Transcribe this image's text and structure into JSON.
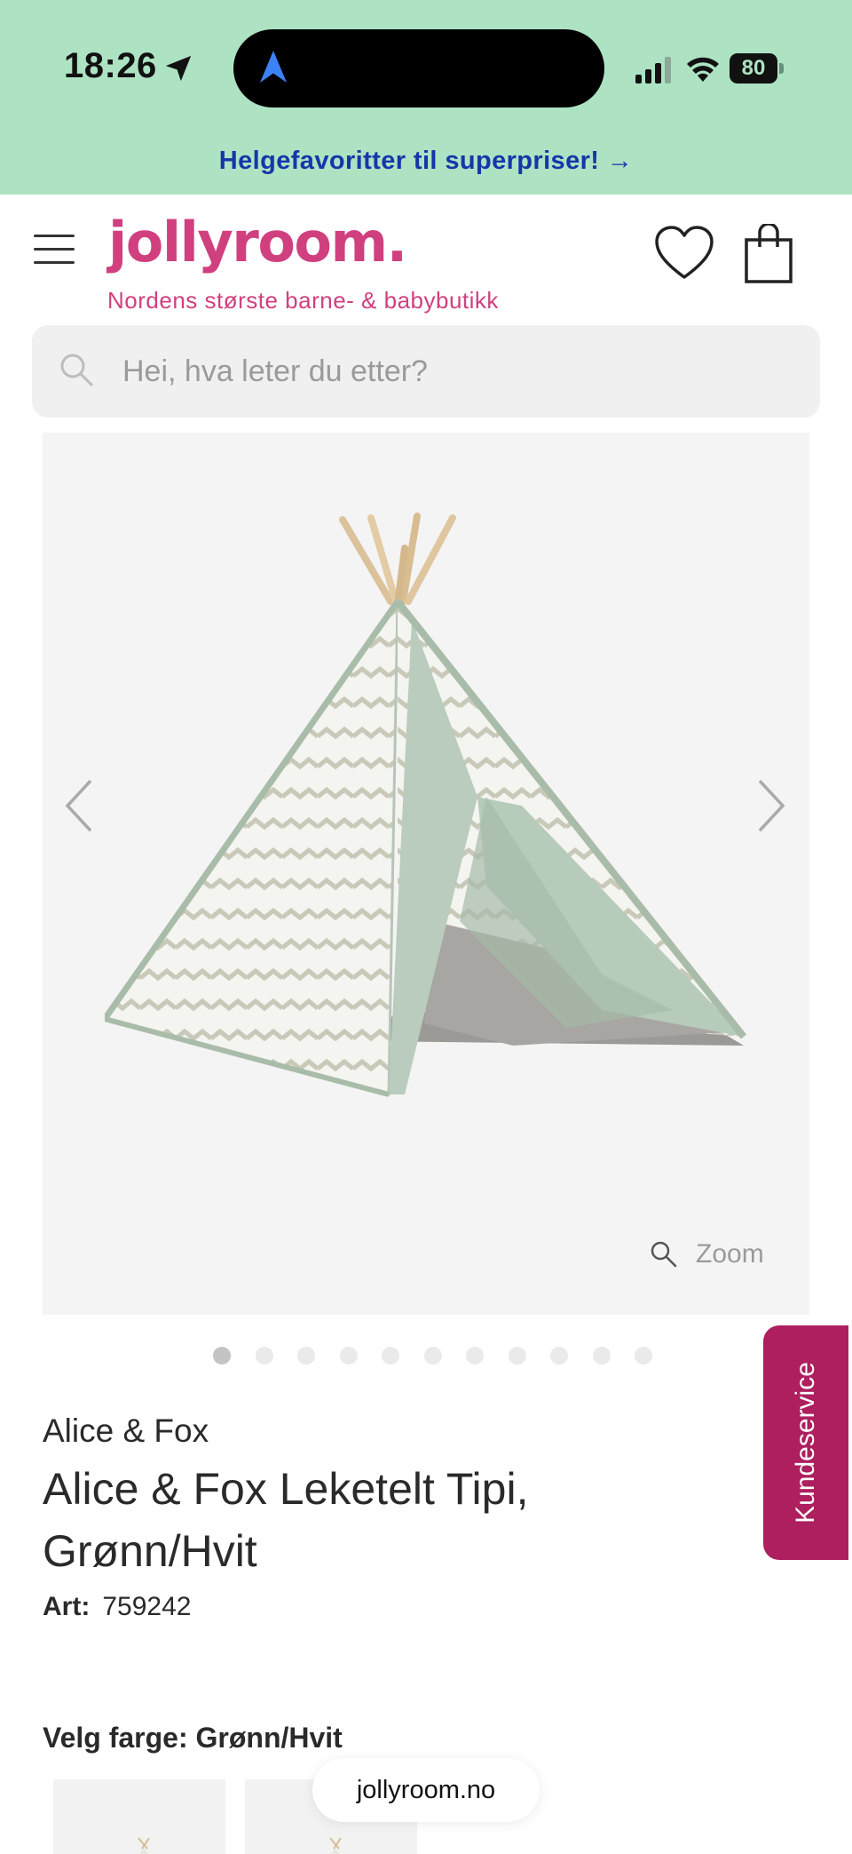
{
  "status_bar": {
    "time": "18:26",
    "battery": "80"
  },
  "promo": {
    "text": "Helgefavoritter til superpriser! →"
  },
  "header": {
    "logo": "jollyroom.",
    "tagline": "Nordens største barne- & babybutikk"
  },
  "search": {
    "placeholder": "Hei, hva leter du etter?"
  },
  "gallery": {
    "zoom_label": "Zoom",
    "image_count": 11,
    "active_index": 0
  },
  "side_tab": {
    "label": "Kundeservice"
  },
  "product": {
    "brand": "Alice & Fox",
    "title": "Alice & Fox Leketelt Tipi, Grønn/Hvit",
    "art_label": "Art:",
    "art_number": "759242",
    "color_label": "Velg farge:",
    "color_value": "Grønn/Hvit"
  },
  "browser": {
    "domain": "jollyroom.no"
  },
  "colors": {
    "brand_pink": "#d0407f",
    "promo_bg": "#ade3c3",
    "promo_text": "#1636a8",
    "service_tab": "#ad1f5e"
  }
}
